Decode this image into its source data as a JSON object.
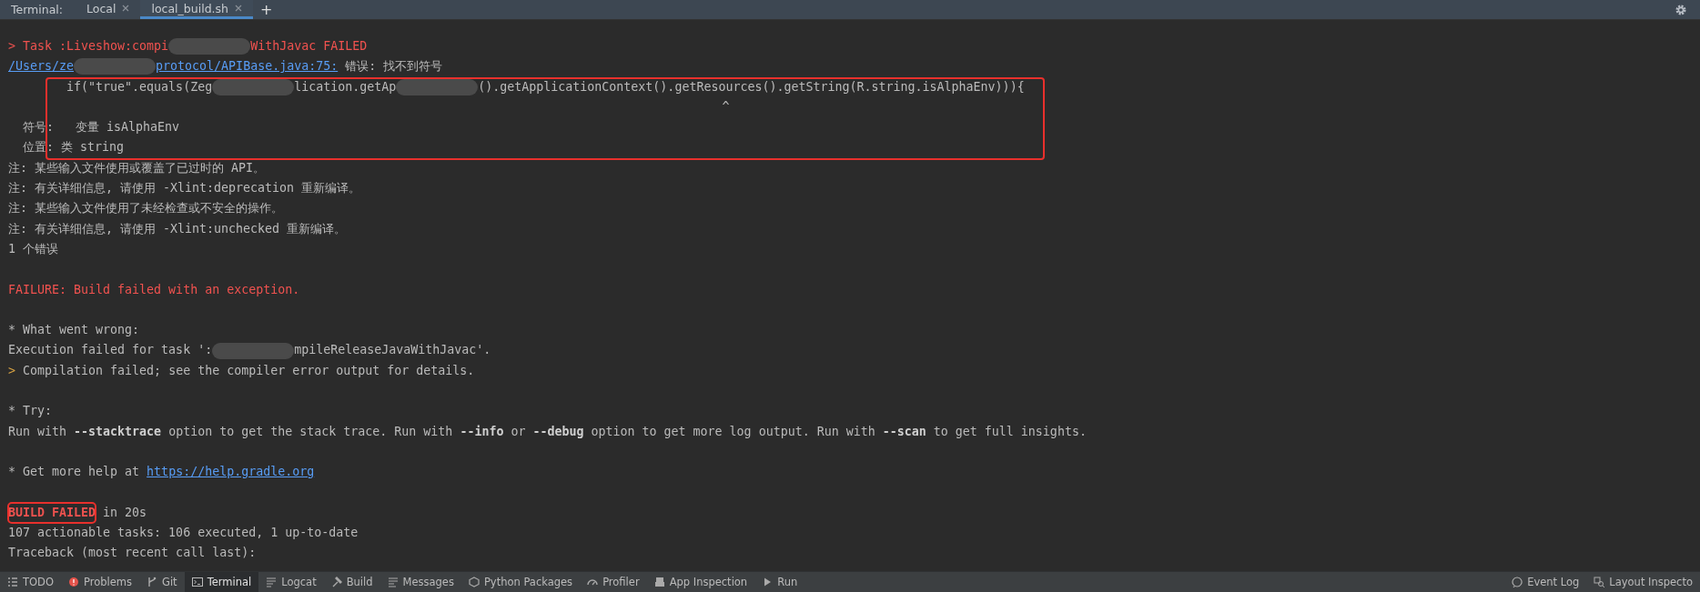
{
  "tab_bar": {
    "label": "Terminal:",
    "tabs": [
      {
        "label": "Local",
        "selected": false,
        "closable": true
      },
      {
        "label": "local_build.sh",
        "selected": true,
        "closable": true
      }
    ],
    "add_button": "+"
  },
  "terminal": {
    "lines": [
      {
        "kind": "text",
        "segments": [
          {
            "kind": "error",
            "text": "> Task :Liveshow:compi"
          },
          {
            "kind": "redacted"
          },
          {
            "kind": "error",
            "text": "WithJavac FAILED"
          }
        ]
      },
      {
        "kind": "text",
        "segments": [
          {
            "kind": "link",
            "text": "/Users/ze"
          },
          {
            "kind": "redacted"
          },
          {
            "kind": "link",
            "text": "protocol/APIBase.java:75:"
          },
          {
            "kind": "plain",
            "text": " 错误: 找不到符号"
          }
        ]
      },
      {
        "kind": "text",
        "boxed": true,
        "segments": [
          {
            "kind": "plain",
            "text": "        if(\"true\".equals(Zeg"
          },
          {
            "kind": "redacted"
          },
          {
            "kind": "plain",
            "text": "lication.getAp"
          },
          {
            "kind": "redacted"
          },
          {
            "kind": "plain",
            "text": "().getApplicationContext().getResources().getString(R.string.isAlphaEnv))){"
          }
        ]
      },
      {
        "kind": "text",
        "boxed": true,
        "segments": [
          {
            "kind": "plain",
            "text": "                                                                                                  ^"
          }
        ]
      },
      {
        "kind": "text",
        "boxed": true,
        "segments": [
          {
            "kind": "plain",
            "text": "  符号:   变量 isAlphaEnv"
          }
        ]
      },
      {
        "kind": "text",
        "boxed": true,
        "segments": [
          {
            "kind": "plain",
            "text": "  位置: 类 string"
          }
        ]
      },
      {
        "kind": "text",
        "segments": [
          {
            "kind": "plain",
            "text": "注: 某些输入文件使用或覆盖了已过时的 API。"
          }
        ]
      },
      {
        "kind": "text",
        "segments": [
          {
            "kind": "plain",
            "text": "注: 有关详细信息, 请使用 -Xlint:deprecation 重新编译。"
          }
        ]
      },
      {
        "kind": "text",
        "segments": [
          {
            "kind": "plain",
            "text": "注: 某些输入文件使用了未经检查或不安全的操作。"
          }
        ]
      },
      {
        "kind": "text",
        "segments": [
          {
            "kind": "plain",
            "text": "注: 有关详细信息, 请使用 -Xlint:unchecked 重新编译。"
          }
        ]
      },
      {
        "kind": "text",
        "segments": [
          {
            "kind": "plain",
            "text": "1 个错误"
          }
        ]
      },
      {
        "kind": "blank"
      },
      {
        "kind": "text",
        "segments": [
          {
            "kind": "error",
            "text": "FAILURE: Build failed with an exception."
          }
        ]
      },
      {
        "kind": "blank"
      },
      {
        "kind": "text",
        "segments": [
          {
            "kind": "plain",
            "text": "* What went wrong:"
          }
        ]
      },
      {
        "kind": "text",
        "segments": [
          {
            "kind": "plain",
            "text": "Execution failed for task ':"
          },
          {
            "kind": "redacted"
          },
          {
            "kind": "plain",
            "text": "mpileReleaseJavaWithJavac'."
          }
        ]
      },
      {
        "kind": "text",
        "segments": [
          {
            "kind": "prompt",
            "text": ">"
          },
          {
            "kind": "plain",
            "text": " Compilation failed; see the compiler error output for details."
          }
        ]
      },
      {
        "kind": "blank"
      },
      {
        "kind": "text",
        "segments": [
          {
            "kind": "plain",
            "text": "* Try:"
          }
        ]
      },
      {
        "kind": "text",
        "segments": [
          {
            "kind": "plain",
            "text": "Run with **--stacktrace** option to get the stack trace. Run with **--info** or **--debug** option to get more log output. Run with **--scan** to get full insights."
          }
        ]
      },
      {
        "kind": "blank"
      },
      {
        "kind": "text",
        "segments": [
          {
            "kind": "plain",
            "text": "* Get more help at "
          },
          {
            "kind": "link",
            "text": "https://help.gradle.org"
          }
        ]
      },
      {
        "kind": "blank"
      },
      {
        "kind": "text",
        "segments": [
          {
            "kind": "error_bold",
            "text": "BUILD FAILED",
            "circled": true
          },
          {
            "kind": "plain",
            "text": " in 20s"
          }
        ]
      },
      {
        "kind": "text",
        "segments": [
          {
            "kind": "plain",
            "text": "107 actionable tasks: 106 executed, 1 up-to-date"
          }
        ]
      },
      {
        "kind": "text",
        "segments": [
          {
            "kind": "plain",
            "text": "Traceback (most recent call last):"
          }
        ]
      }
    ]
  },
  "tool_windows": [
    {
      "kind": "todo",
      "label": "TODO",
      "selected": false
    },
    {
      "kind": "problems",
      "label": "Problems",
      "selected": false
    },
    {
      "kind": "git",
      "label": "Git",
      "selected": false
    },
    {
      "kind": "terminal",
      "label": "Terminal",
      "selected": true
    },
    {
      "kind": "logcat",
      "label": "Logcat",
      "selected": false
    },
    {
      "kind": "build",
      "label": "Build",
      "selected": false
    },
    {
      "kind": "messages",
      "label": "Messages",
      "selected": false
    },
    {
      "kind": "python",
      "label": "Python Packages",
      "selected": false
    },
    {
      "kind": "profiler",
      "label": "Profiler",
      "selected": false
    },
    {
      "kind": "inspection",
      "label": "App Inspection",
      "selected": false
    },
    {
      "kind": "run",
      "label": "Run",
      "selected": false
    }
  ],
  "right_tool_windows": [
    {
      "kind": "eventlog",
      "label": "Event Log",
      "selected": false
    },
    {
      "kind": "layout",
      "label": "Layout Inspecto",
      "selected": false
    }
  ]
}
